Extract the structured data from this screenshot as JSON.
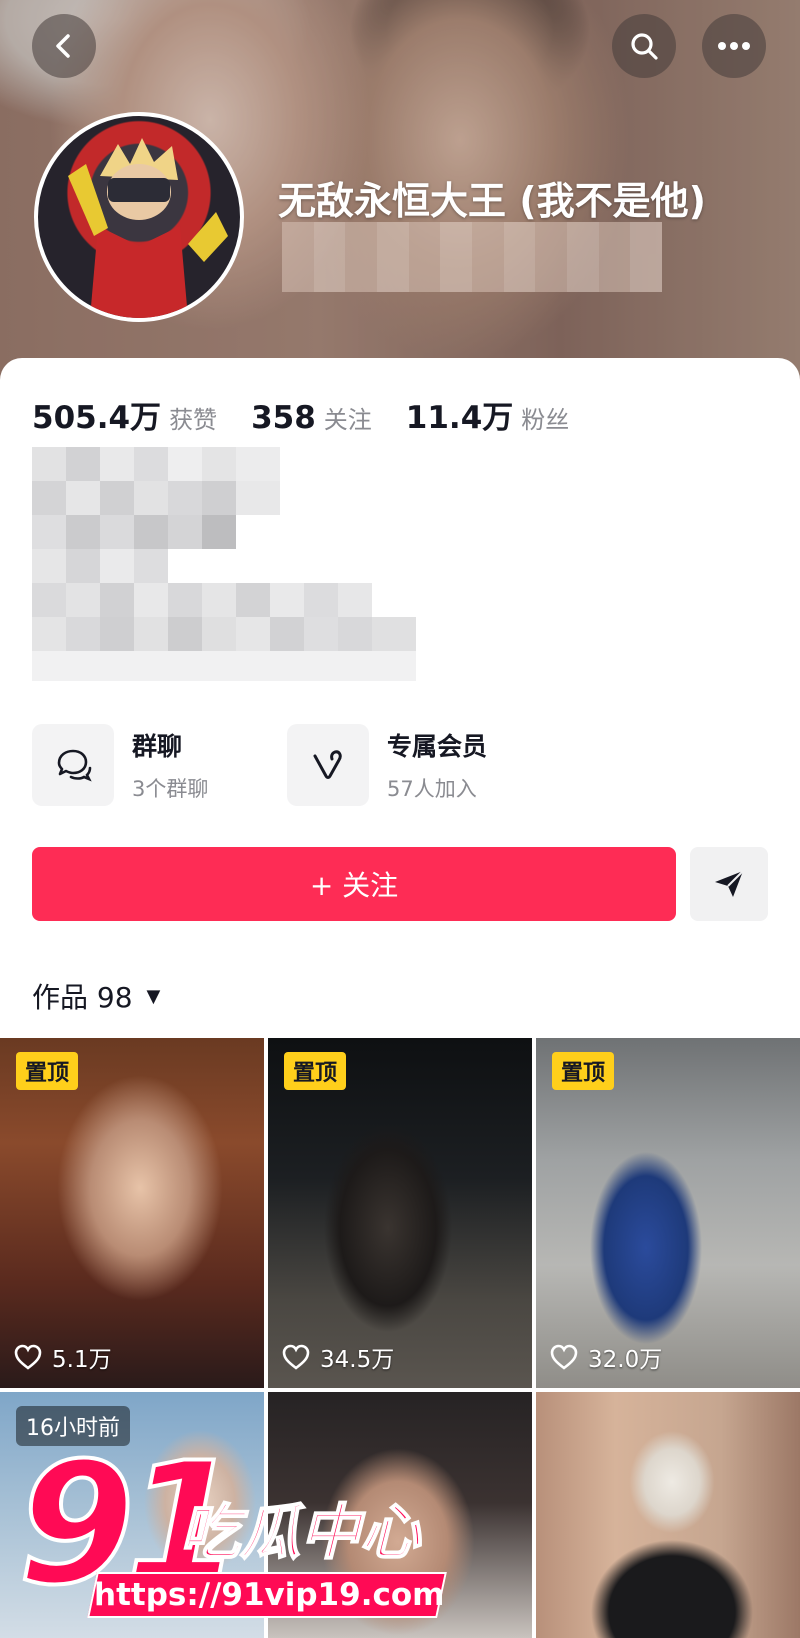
{
  "header": {
    "back_icon": "chevron-left-icon",
    "search_icon": "search-icon",
    "more_icon": "more-horizontal-icon",
    "nickname": "无敌永恒大王 (我不是他)"
  },
  "stats": [
    {
      "value": "505.4万",
      "label": "获赞"
    },
    {
      "value": "358",
      "label": "关注"
    },
    {
      "value": "11.4万",
      "label": "粉丝"
    }
  ],
  "features": {
    "group": {
      "icon": "chat-bubbles-icon",
      "title": "群聊",
      "subtitle": "3个群聊"
    },
    "member": {
      "icon": "heart-v-icon",
      "title": "专属会员",
      "subtitle": "57人加入"
    }
  },
  "actions": {
    "follow_label": "+ 关注",
    "share_icon": "send-icon"
  },
  "works": {
    "label": "作品 98",
    "caret": "▼"
  },
  "videos": [
    {
      "badge": "置顶",
      "likes": "5.1万"
    },
    {
      "badge": "置顶",
      "likes": "34.5万"
    },
    {
      "badge": "置顶",
      "likes": "32.0万"
    },
    {
      "badge": "16小时前",
      "likes": ""
    },
    {
      "badge": "",
      "likes": ""
    },
    {
      "badge": "",
      "likes": ""
    }
  ],
  "watermark": {
    "big": "91",
    "text": "吃瓜中心",
    "url": "https://91vip19.com"
  },
  "colors": {
    "accent": "#fe2c55",
    "pin_badge": "#ffcf1b",
    "watermark": "#ff0a55"
  }
}
